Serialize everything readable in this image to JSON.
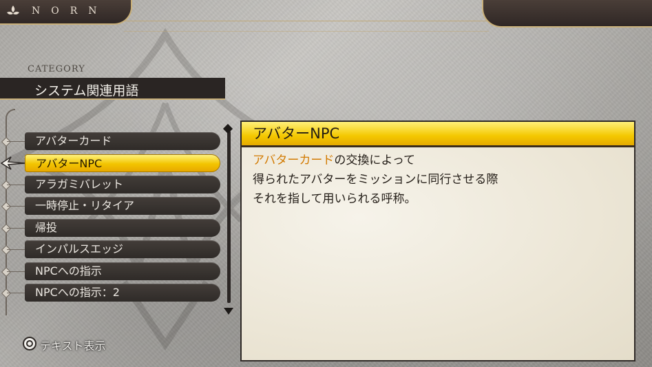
{
  "app": {
    "brand": "NORN"
  },
  "category": {
    "label": "CATEGORY",
    "title": "システム関連用語"
  },
  "menu": {
    "items": [
      {
        "label": "アバターカード"
      },
      {
        "label": "アバターNPC"
      },
      {
        "label": "アラガミバレット"
      },
      {
        "label": "一時停止・リタイア"
      },
      {
        "label": "帰投"
      },
      {
        "label": "インパルスエッジ"
      },
      {
        "label": "NPCへの指示"
      },
      {
        "label": "NPCへの指示：2"
      }
    ],
    "selected_index": 1
  },
  "detail": {
    "title": "アバターNPC",
    "highlight": "アバターカード",
    "line1_rest": "の交換によって",
    "line2": "得られたアバターをミッションに同行させる際",
    "line3": "それを指して用いられる呼称。"
  },
  "footer": {
    "button_icon": "circle-button-icon",
    "label": "テキスト表示"
  },
  "colors": {
    "accent_yellow": "#f4c800",
    "highlight_orange": "#d27a00",
    "gold_trim": "#c9b07a",
    "dark_bar": "#2a2523"
  }
}
